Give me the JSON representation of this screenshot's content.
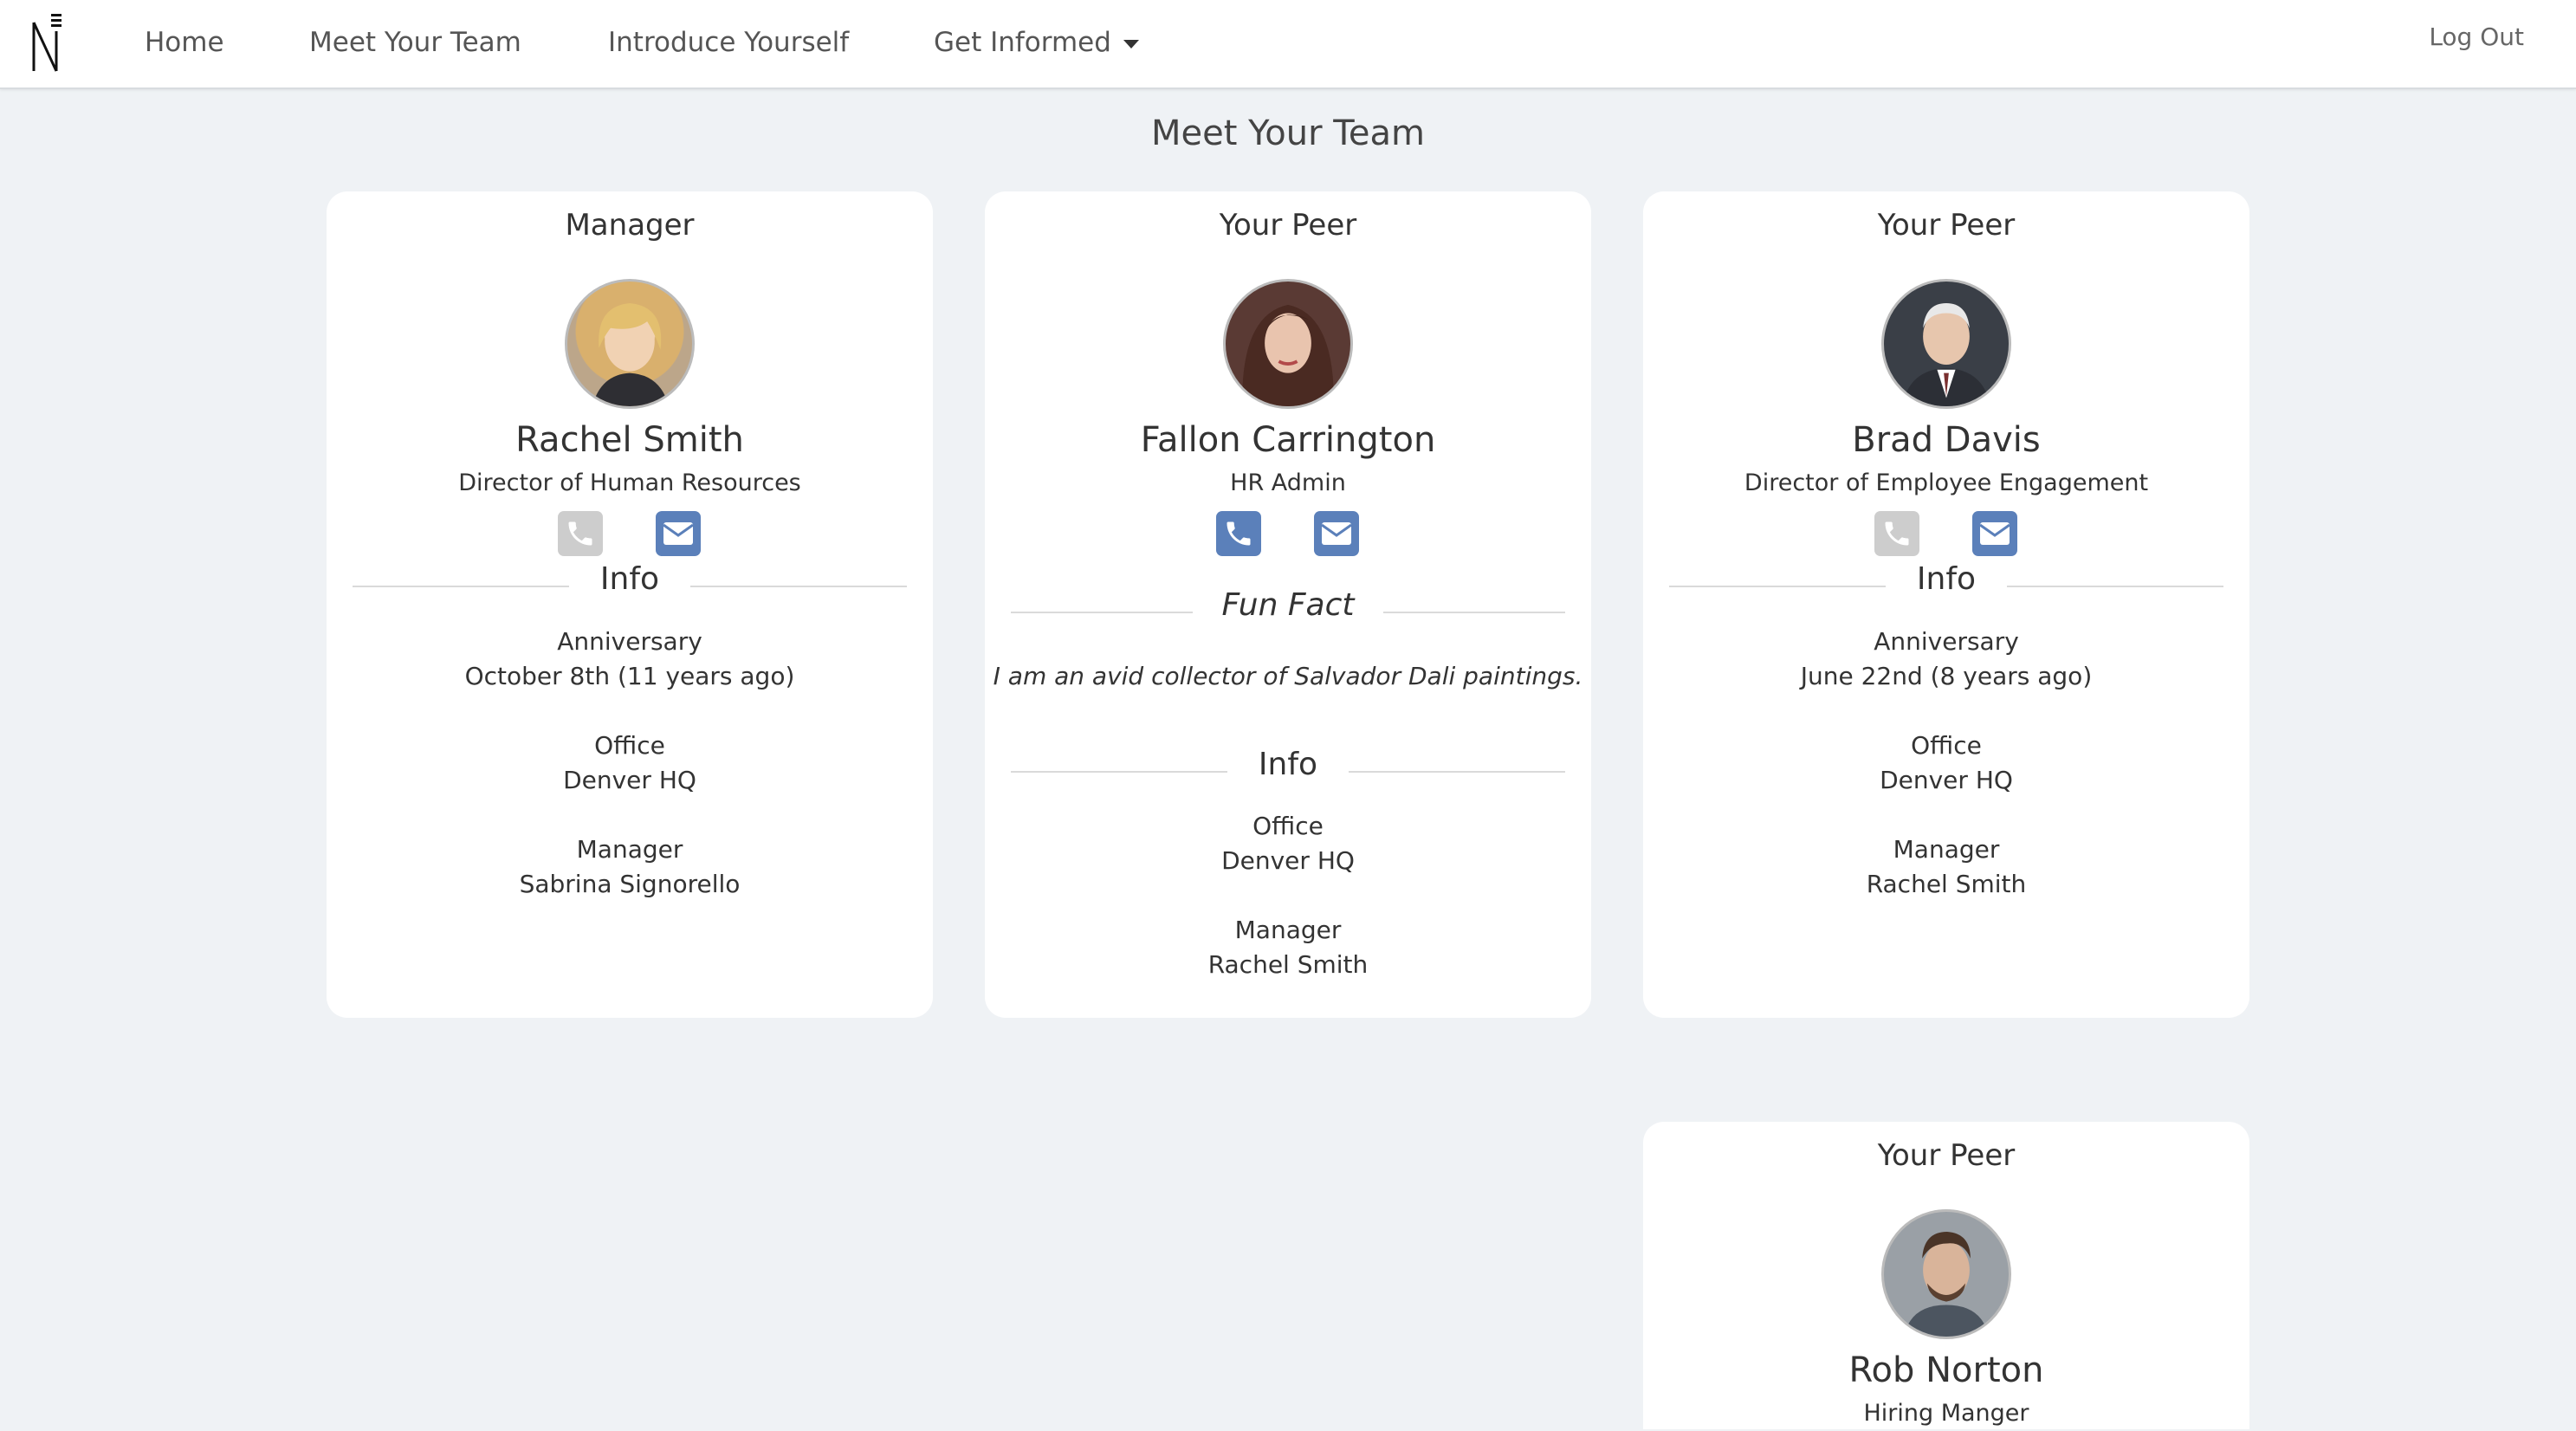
{
  "nav": {
    "items": [
      {
        "label": "Home"
      },
      {
        "label": "Meet Your Team"
      },
      {
        "label": "Introduce Yourself"
      },
      {
        "label": "Get Informed"
      }
    ],
    "logout": "Log Out"
  },
  "page": {
    "title": "Meet Your Team"
  },
  "cards": [
    {
      "role": "Manager",
      "name": "Rachel Smith",
      "title": "Director of Human Resources",
      "phone_enabled": false,
      "email_enabled": true,
      "info_label": "Info",
      "anniversary_label": "Anniversary",
      "anniversary_value": "October 8th (11 years ago)",
      "office_label": "Office",
      "office_value": "Denver HQ",
      "manager_label": "Manager",
      "manager_value": "Sabrina Signorello"
    },
    {
      "role": "Your Peer",
      "name": "Fallon Carrington",
      "title": "HR Admin",
      "phone_enabled": true,
      "email_enabled": true,
      "fun_fact_label": "Fun Fact",
      "fun_fact": "I am an avid collector of Salvador Dali paintings.",
      "info_label": "Info",
      "office_label": "Office",
      "office_value": "Denver HQ",
      "manager_label": "Manager",
      "manager_value": "Rachel Smith"
    },
    {
      "role": "Your Peer",
      "name": "Brad Davis",
      "title": "Director of Employee Engagement",
      "phone_enabled": false,
      "email_enabled": true,
      "info_label": "Info",
      "anniversary_label": "Anniversary",
      "anniversary_value": "June 22nd (8 years ago)",
      "office_label": "Office",
      "office_value": "Denver HQ",
      "manager_label": "Manager",
      "manager_value": "Rachel Smith"
    },
    {
      "role": "Your Peer",
      "name": "Rob Norton",
      "title": "Hiring Manger"
    }
  ],
  "icons": {
    "phone": "phone-icon",
    "email": "envelope-icon",
    "dropdown": "caret-down-icon"
  },
  "colors": {
    "background": "#eff2f5",
    "card": "#ffffff",
    "icon_active": "#5b80ba",
    "icon_disabled": "#cdcdcd"
  }
}
